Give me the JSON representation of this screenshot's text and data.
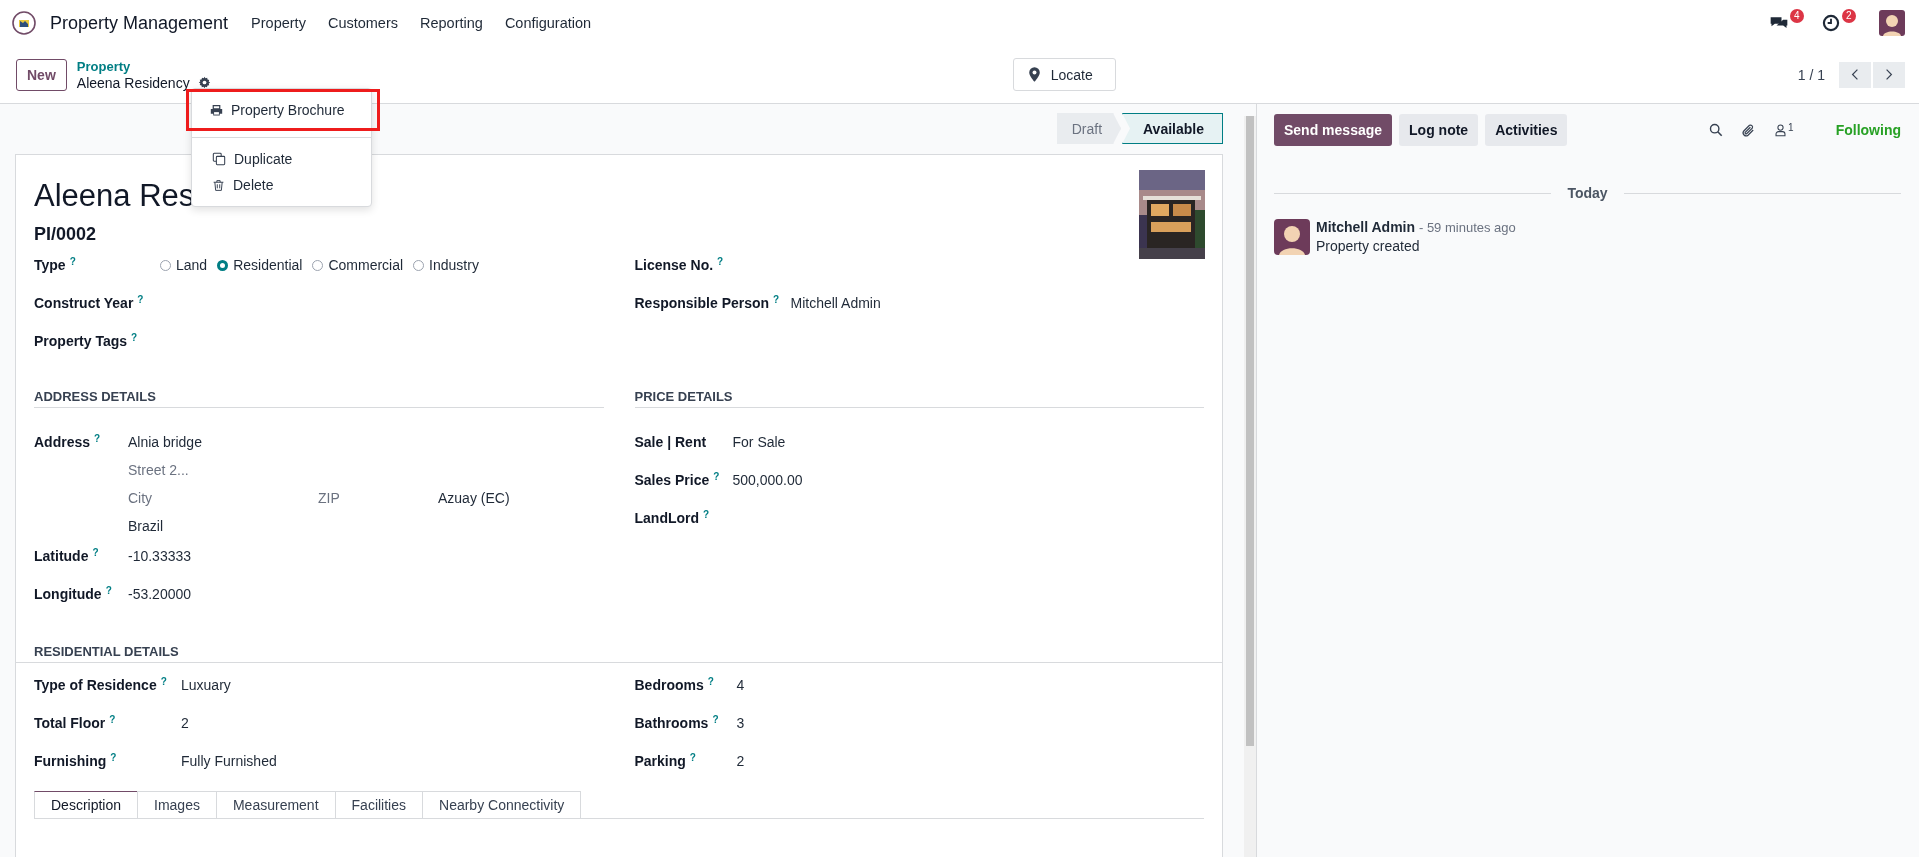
{
  "navbar": {
    "app_name": "Property Management",
    "menu": [
      "Property",
      "Customers",
      "Reporting",
      "Configuration"
    ],
    "messages_badge": "4",
    "activities_badge": "2"
  },
  "control_panel": {
    "new_button": "New",
    "breadcrumb": "Property",
    "record_name": "Aleena Residency",
    "locate_button": "Locate",
    "pager": "1 / 1"
  },
  "actions_menu": [
    {
      "label": "Property Brochure",
      "kind": "print",
      "highlighted": true
    },
    {
      "label": "Duplicate",
      "kind": "duplicate",
      "highlighted": false
    },
    {
      "label": "Delete",
      "kind": "delete",
      "highlighted": false
    }
  ],
  "status_bar": [
    {
      "label": "Draft",
      "selected": false
    },
    {
      "label": "Available",
      "selected": true
    }
  ],
  "form": {
    "title": "Aleena Res",
    "reference": "PI/0002",
    "left_fields": [
      {
        "label": "Type",
        "help": "?",
        "kind": "radio",
        "options": [
          {
            "label": "Land",
            "selected": false
          },
          {
            "label": "Residential",
            "selected": true
          },
          {
            "label": "Commercial",
            "selected": false
          },
          {
            "label": "Industry",
            "selected": false
          }
        ]
      },
      {
        "label": "Construct Year",
        "help": "?",
        "kind": "text"
      },
      {
        "label": "Property Tags",
        "help": "?",
        "kind": "text"
      }
    ],
    "right_fields": [
      {
        "label": "License No.",
        "help": "?",
        "kind": "text"
      },
      {
        "label": "Responsible Person",
        "help": "?",
        "kind": "text",
        "value": "Mitchell Admin"
      }
    ],
    "address_section": {
      "heading": "ADDRESS DETAILS",
      "fields": [
        {
          "label": "Address",
          "help": "?",
          "kind": "address",
          "street": "Alnia bridge",
          "street2_placeholder": "Street 2...",
          "city_placeholder": "City",
          "zip_placeholder": "ZIP",
          "state": "Azuay (EC)",
          "country": "Brazil"
        },
        {
          "label": "Latitude",
          "help": "?",
          "kind": "text",
          "value": "-10.33333"
        },
        {
          "label": "Longitude",
          "help": "?",
          "kind": "text",
          "value": "-53.20000"
        }
      ]
    },
    "price_section": {
      "heading": "PRICE DETAILS",
      "fields": [
        {
          "label": "Sale | Rent",
          "kind": "text",
          "value": "For Sale"
        },
        {
          "label": "Sales Price",
          "help": "?",
          "kind": "text",
          "value": "500,000.00"
        },
        {
          "label": "LandLord",
          "help": "?",
          "kind": "text"
        }
      ]
    },
    "residential_section": {
      "heading": "RESIDENTIAL DETAILS",
      "left_fields": [
        {
          "label": "Type of Residence",
          "help": "?",
          "kind": "text",
          "value": "Luxuary"
        },
        {
          "label": "Total Floor",
          "help": "?",
          "kind": "text",
          "value": "2"
        },
        {
          "label": "Furnishing",
          "help": "?",
          "kind": "text",
          "value": "Fully Furnished"
        }
      ],
      "right_fields": [
        {
          "label": "Bedrooms",
          "help": "?",
          "kind": "text",
          "value": "4"
        },
        {
          "label": "Bathrooms",
          "help": "?",
          "kind": "text",
          "value": "3"
        },
        {
          "label": "Parking",
          "help": "?",
          "kind": "text",
          "value": "2"
        }
      ]
    },
    "tabs": [
      {
        "label": "Description",
        "selected": true
      },
      {
        "label": "Images",
        "selected": false
      },
      {
        "label": "Measurement",
        "selected": false
      },
      {
        "label": "Facilities",
        "selected": false
      },
      {
        "label": "Nearby Connectivity",
        "selected": false
      }
    ]
  },
  "chatter": {
    "buttons": [
      {
        "label": "Send message",
        "selected": true
      },
      {
        "label": "Log note",
        "selected": false
      },
      {
        "label": "Activities",
        "selected": false
      }
    ],
    "follower_count": "1",
    "following": "Following",
    "separator": "Today",
    "messages": [
      {
        "author": "Mitchell Admin",
        "time": "- 59 minutes ago",
        "body": "Property created"
      }
    ]
  }
}
